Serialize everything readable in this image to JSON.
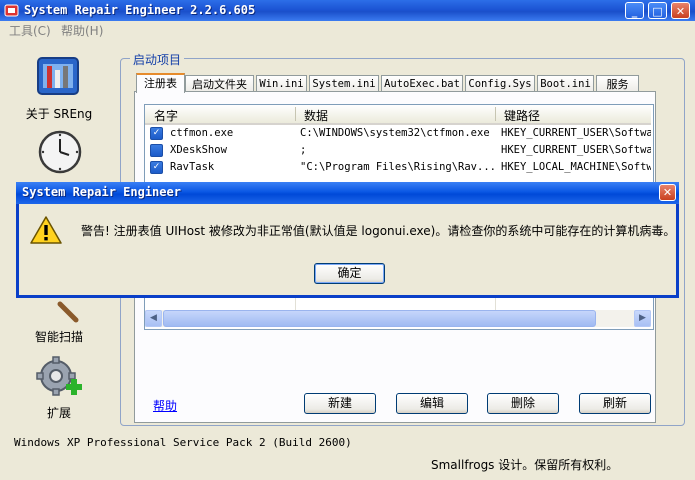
{
  "window": {
    "title": "System Repair Engineer 2.2.6.605"
  },
  "titlebar_buttons": {
    "minimize": "_",
    "maximize": "□",
    "close": "✕"
  },
  "menu": [
    "工具(C)",
    "帮助(H)"
  ],
  "nav": {
    "items": [
      {
        "label": "关于 SREng",
        "icon": "toolbox-icon"
      },
      {
        "label": "",
        "icon": "clock-icon"
      },
      {
        "label": "智能扫描",
        "icon": "magnifier-icon"
      },
      {
        "label": "扩展",
        "icon": "gear-plus-icon"
      }
    ]
  },
  "group": {
    "title": "启动项目"
  },
  "tabs": [
    "注册表",
    "启动文件夹",
    "Win.ini",
    "System.ini",
    "AutoExec.bat",
    "Config.Sys",
    "Boot.ini",
    "服务"
  ],
  "table": {
    "columns": [
      "名字",
      "数据",
      "键路径"
    ],
    "rows": [
      {
        "name": "ctfmon.exe",
        "data": "C:\\WINDOWS\\system32\\ctfmon.exe",
        "key": "HKEY_CURRENT_USER\\Softwar"
      },
      {
        "name": "XDeskShow",
        "data": ";",
        "key": "HKEY_CURRENT_USER\\Softwar"
      },
      {
        "name": "RavTask",
        "data": "\"C:\\Program Files\\Rising\\Rav...",
        "key": "HKEY_LOCAL_MACHINE\\Softwa"
      }
    ]
  },
  "help_link": "帮助",
  "buttons": [
    "新建",
    "编辑",
    "删除",
    "刷新"
  ],
  "status": "Windows XP Professional Service Pack 2 (Build 2600)",
  "copyright": "Smallfrogs 设计。保留所有权利。",
  "dialog": {
    "title": "System Repair Engineer",
    "message": "警告! 注册表值 UIHost 被修改为非正常值(默认值是 logonui.exe)。请检查你的系统中可能存在的计算机病毒。",
    "ok": "确定",
    "icon": "warning-icon"
  },
  "colors": {
    "titlebar": "#1c54d4",
    "accent": "#e68b2c",
    "link": "#0000ff"
  }
}
